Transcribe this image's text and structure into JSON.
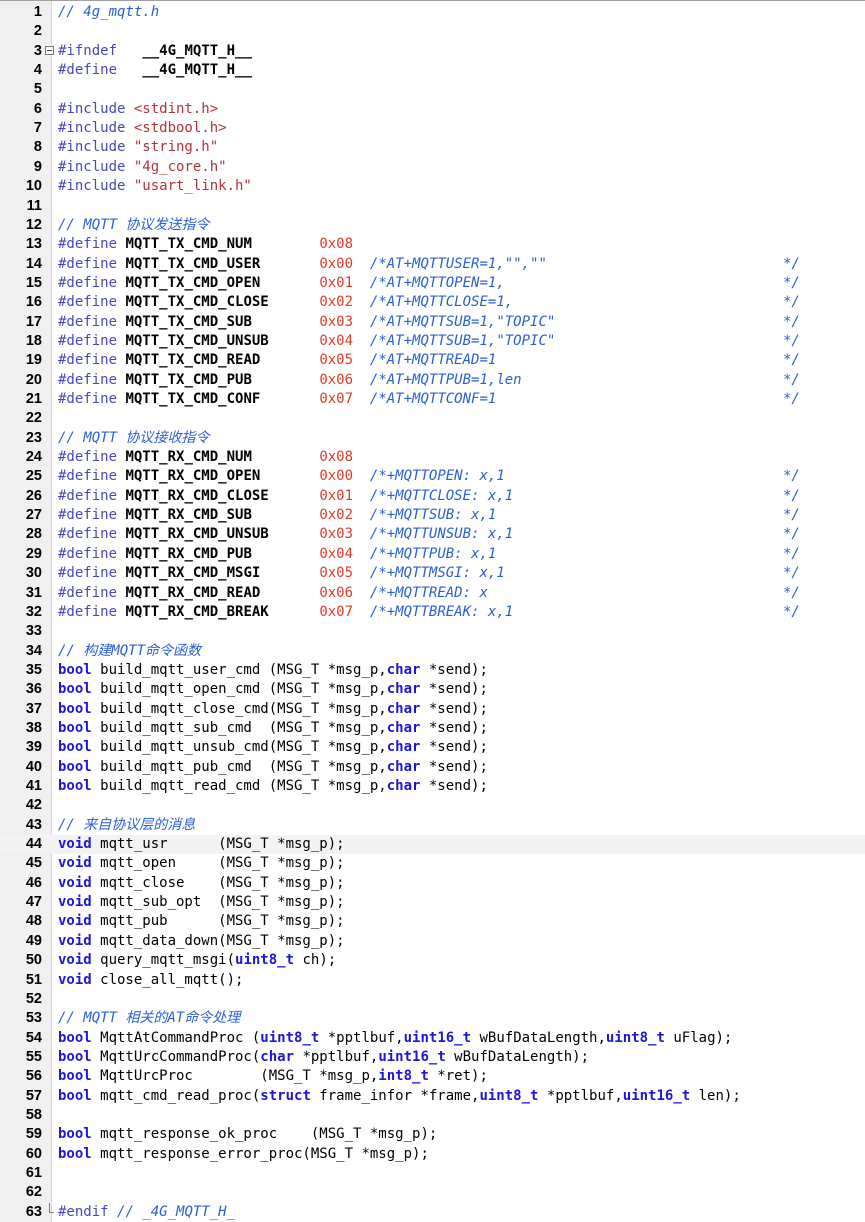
{
  "file_title": "4g_mqtt.h",
  "colors": {
    "preprocessor": "#4848b8",
    "comment": "#2a5fd4",
    "string": "#b2333a",
    "number": "#e03a28",
    "keyword_type": "#1c17d6",
    "gutter_bg": "#f0f0f0"
  },
  "lines": [
    [
      [
        "cm",
        "// 4g_mqtt.h"
      ]
    ],
    [],
    [
      [
        "pp",
        "#ifndef"
      ],
      [
        "pl",
        "   "
      ],
      [
        "def",
        "__4G_MQTT_H__"
      ]
    ],
    [
      [
        "pp",
        "#define"
      ],
      [
        "pl",
        "   "
      ],
      [
        "def",
        "__4G_MQTT_H__"
      ]
    ],
    [],
    [
      [
        "pp",
        "#include "
      ],
      [
        "str",
        "<stdint.h>"
      ]
    ],
    [
      [
        "pp",
        "#include "
      ],
      [
        "str",
        "<stdbool.h>"
      ]
    ],
    [
      [
        "pp",
        "#include "
      ],
      [
        "str",
        "\"string.h\""
      ]
    ],
    [
      [
        "pp",
        "#include "
      ],
      [
        "str",
        "\"4g_core.h\""
      ]
    ],
    [
      [
        "pp",
        "#include "
      ],
      [
        "str",
        "\"usart_link.h\""
      ]
    ],
    [],
    [
      [
        "cm",
        "// MQTT 协议发送指令"
      ]
    ],
    [
      [
        "pp",
        "#define "
      ],
      [
        "def",
        "MQTT_TX_CMD_NUM"
      ],
      [
        "pl",
        "        "
      ],
      [
        "num",
        "0x08"
      ]
    ],
    [
      [
        "pp",
        "#define "
      ],
      [
        "def",
        "MQTT_TX_CMD_USER"
      ],
      [
        "pl",
        "       "
      ],
      [
        "num",
        "0x00"
      ],
      [
        "pl",
        "  "
      ],
      [
        "cm",
        "/*AT+MQTTUSER=1,\"\",\"\""
      ],
      [
        "cmend",
        "*/"
      ]
    ],
    [
      [
        "pp",
        "#define "
      ],
      [
        "def",
        "MQTT_TX_CMD_OPEN"
      ],
      [
        "pl",
        "       "
      ],
      [
        "num",
        "0x01"
      ],
      [
        "pl",
        "  "
      ],
      [
        "cm",
        "/*AT+MQTTOPEN=1,"
      ],
      [
        "cmend",
        "*/"
      ]
    ],
    [
      [
        "pp",
        "#define "
      ],
      [
        "def",
        "MQTT_TX_CMD_CLOSE"
      ],
      [
        "pl",
        "      "
      ],
      [
        "num",
        "0x02"
      ],
      [
        "pl",
        "  "
      ],
      [
        "cm",
        "/*AT+MQTTCLOSE=1,"
      ],
      [
        "cmend",
        "*/"
      ]
    ],
    [
      [
        "pp",
        "#define "
      ],
      [
        "def",
        "MQTT_TX_CMD_SUB"
      ],
      [
        "pl",
        "        "
      ],
      [
        "num",
        "0x03"
      ],
      [
        "pl",
        "  "
      ],
      [
        "cm",
        "/*AT+MQTTSUB=1,\"TOPIC\""
      ],
      [
        "cmend",
        "*/"
      ]
    ],
    [
      [
        "pp",
        "#define "
      ],
      [
        "def",
        "MQTT_TX_CMD_UNSUB"
      ],
      [
        "pl",
        "      "
      ],
      [
        "num",
        "0x04"
      ],
      [
        "pl",
        "  "
      ],
      [
        "cm",
        "/*AT+MQTTSUB=1,\"TOPIC\""
      ],
      [
        "cmend",
        "*/"
      ]
    ],
    [
      [
        "pp",
        "#define "
      ],
      [
        "def",
        "MQTT_TX_CMD_READ"
      ],
      [
        "pl",
        "       "
      ],
      [
        "num",
        "0x05"
      ],
      [
        "pl",
        "  "
      ],
      [
        "cm",
        "/*AT+MQTTREAD=1"
      ],
      [
        "cmend",
        "*/"
      ]
    ],
    [
      [
        "pp",
        "#define "
      ],
      [
        "def",
        "MQTT_TX_CMD_PUB"
      ],
      [
        "pl",
        "        "
      ],
      [
        "num",
        "0x06"
      ],
      [
        "pl",
        "  "
      ],
      [
        "cm",
        "/*AT+MQTTPUB=1,len"
      ],
      [
        "cmend",
        "*/"
      ]
    ],
    [
      [
        "pp",
        "#define "
      ],
      [
        "def",
        "MQTT_TX_CMD_CONF"
      ],
      [
        "pl",
        "       "
      ],
      [
        "num",
        "0x07"
      ],
      [
        "pl",
        "  "
      ],
      [
        "cm",
        "/*AT+MQTTCONF=1"
      ],
      [
        "cmend",
        "*/"
      ]
    ],
    [],
    [
      [
        "cm",
        "// MQTT 协议接收指令"
      ]
    ],
    [
      [
        "pp",
        "#define "
      ],
      [
        "def",
        "MQTT_RX_CMD_NUM"
      ],
      [
        "pl",
        "        "
      ],
      [
        "num",
        "0x08"
      ]
    ],
    [
      [
        "pp",
        "#define "
      ],
      [
        "def",
        "MQTT_RX_CMD_OPEN"
      ],
      [
        "pl",
        "       "
      ],
      [
        "num",
        "0x00"
      ],
      [
        "pl",
        "  "
      ],
      [
        "cm",
        "/*+MQTTOPEN: x,1"
      ],
      [
        "cmend",
        "*/"
      ]
    ],
    [
      [
        "pp",
        "#define "
      ],
      [
        "def",
        "MQTT_RX_CMD_CLOSE"
      ],
      [
        "pl",
        "      "
      ],
      [
        "num",
        "0x01"
      ],
      [
        "pl",
        "  "
      ],
      [
        "cm",
        "/*+MQTTCLOSE: x,1"
      ],
      [
        "cmend",
        "*/"
      ]
    ],
    [
      [
        "pp",
        "#define "
      ],
      [
        "def",
        "MQTT_RX_CMD_SUB"
      ],
      [
        "pl",
        "        "
      ],
      [
        "num",
        "0x02"
      ],
      [
        "pl",
        "  "
      ],
      [
        "cm",
        "/*+MQTTSUB: x,1"
      ],
      [
        "cmend",
        "*/"
      ]
    ],
    [
      [
        "pp",
        "#define "
      ],
      [
        "def",
        "MQTT_RX_CMD_UNSUB"
      ],
      [
        "pl",
        "      "
      ],
      [
        "num",
        "0x03"
      ],
      [
        "pl",
        "  "
      ],
      [
        "cm",
        "/*+MQTTUNSUB: x,1"
      ],
      [
        "cmend",
        "*/"
      ]
    ],
    [
      [
        "pp",
        "#define "
      ],
      [
        "def",
        "MQTT_RX_CMD_PUB"
      ],
      [
        "pl",
        "        "
      ],
      [
        "num",
        "0x04"
      ],
      [
        "pl",
        "  "
      ],
      [
        "cm",
        "/*+MQTTPUB: x,1"
      ],
      [
        "cmend",
        "*/"
      ]
    ],
    [
      [
        "pp",
        "#define "
      ],
      [
        "def",
        "MQTT_RX_CMD_MSGI"
      ],
      [
        "pl",
        "       "
      ],
      [
        "num",
        "0x05"
      ],
      [
        "pl",
        "  "
      ],
      [
        "cm",
        "/*+MQTTMSGI: x,1"
      ],
      [
        "cmend",
        "*/"
      ]
    ],
    [
      [
        "pp",
        "#define "
      ],
      [
        "def",
        "MQTT_RX_CMD_READ"
      ],
      [
        "pl",
        "       "
      ],
      [
        "num",
        "0x06"
      ],
      [
        "pl",
        "  "
      ],
      [
        "cm",
        "/*+MQTTREAD: x"
      ],
      [
        "cmend",
        "*/"
      ]
    ],
    [
      [
        "pp",
        "#define "
      ],
      [
        "def",
        "MQTT_RX_CMD_BREAK"
      ],
      [
        "pl",
        "      "
      ],
      [
        "num",
        "0x07"
      ],
      [
        "pl",
        "  "
      ],
      [
        "cm",
        "/*+MQTTBREAK: x,1"
      ],
      [
        "cmend",
        "*/"
      ]
    ],
    [],
    [
      [
        "cm",
        "// 构建MQTT命令函数"
      ]
    ],
    [
      [
        "type",
        "bool"
      ],
      [
        "id",
        " build_mqtt_user_cmd (MSG_T *msg_p,"
      ],
      [
        "type",
        "char"
      ],
      [
        "id",
        " *send);"
      ]
    ],
    [
      [
        "type",
        "bool"
      ],
      [
        "id",
        " build_mqtt_open_cmd (MSG_T *msg_p,"
      ],
      [
        "type",
        "char"
      ],
      [
        "id",
        " *send);"
      ]
    ],
    [
      [
        "type",
        "bool"
      ],
      [
        "id",
        " build_mqtt_close_cmd(MSG_T *msg_p,"
      ],
      [
        "type",
        "char"
      ],
      [
        "id",
        " *send);"
      ]
    ],
    [
      [
        "type",
        "bool"
      ],
      [
        "id",
        " build_mqtt_sub_cmd  (MSG_T *msg_p,"
      ],
      [
        "type",
        "char"
      ],
      [
        "id",
        " *send);"
      ]
    ],
    [
      [
        "type",
        "bool"
      ],
      [
        "id",
        " build_mqtt_unsub_cmd(MSG_T *msg_p,"
      ],
      [
        "type",
        "char"
      ],
      [
        "id",
        " *send);"
      ]
    ],
    [
      [
        "type",
        "bool"
      ],
      [
        "id",
        " build_mqtt_pub_cmd  (MSG_T *msg_p,"
      ],
      [
        "type",
        "char"
      ],
      [
        "id",
        " *send);"
      ]
    ],
    [
      [
        "type",
        "bool"
      ],
      [
        "id",
        " build_mqtt_read_cmd (MSG_T *msg_p,"
      ],
      [
        "type",
        "char"
      ],
      [
        "id",
        " *send);"
      ]
    ],
    [],
    [
      [
        "cm",
        "// 来自协议层的消息"
      ]
    ],
    [
      [
        "type",
        "void"
      ],
      [
        "id",
        " mqtt_usr      (MSG_T *msg_p);"
      ]
    ],
    [
      [
        "type",
        "void"
      ],
      [
        "id",
        " mqtt_open     (MSG_T *msg_p);"
      ]
    ],
    [
      [
        "type",
        "void"
      ],
      [
        "id",
        " mqtt_close    (MSG_T *msg_p);"
      ]
    ],
    [
      [
        "type",
        "void"
      ],
      [
        "id",
        " mqtt_sub_opt  (MSG_T *msg_p);"
      ]
    ],
    [
      [
        "type",
        "void"
      ],
      [
        "id",
        " mqtt_pub      (MSG_T *msg_p);"
      ]
    ],
    [
      [
        "type",
        "void"
      ],
      [
        "id",
        " mqtt_data_down(MSG_T *msg_p);"
      ]
    ],
    [
      [
        "type",
        "void"
      ],
      [
        "id",
        " query_mqtt_msgi("
      ],
      [
        "type",
        "uint8_t"
      ],
      [
        "id",
        " ch);"
      ]
    ],
    [
      [
        "type",
        "void"
      ],
      [
        "id",
        " close_all_mqtt();"
      ]
    ],
    [],
    [
      [
        "cm",
        "// MQTT 相关的AT命令处理"
      ]
    ],
    [
      [
        "type",
        "bool"
      ],
      [
        "id",
        " MqttAtCommandProc ("
      ],
      [
        "type",
        "uint8_t"
      ],
      [
        "id",
        " *pptlbuf,"
      ],
      [
        "type",
        "uint16_t"
      ],
      [
        "id",
        " wBufDataLength,"
      ],
      [
        "type",
        "uint8_t"
      ],
      [
        "id",
        " uFlag);"
      ]
    ],
    [
      [
        "type",
        "bool"
      ],
      [
        "id",
        " MqttUrcCommandProc("
      ],
      [
        "type",
        "char"
      ],
      [
        "id",
        " *pptlbuf,"
      ],
      [
        "type",
        "uint16_t"
      ],
      [
        "id",
        " wBufDataLength);"
      ]
    ],
    [
      [
        "type",
        "bool"
      ],
      [
        "id",
        " MqttUrcProc        (MSG_T *msg_p,"
      ],
      [
        "type",
        "int8_t"
      ],
      [
        "id",
        " *ret);"
      ]
    ],
    [
      [
        "type",
        "bool"
      ],
      [
        "id",
        " mqtt_cmd_read_proc("
      ],
      [
        "type",
        "struct"
      ],
      [
        "id",
        " frame_infor *frame,"
      ],
      [
        "type",
        "uint8_t"
      ],
      [
        "id",
        " *pptlbuf,"
      ],
      [
        "type",
        "uint16_t"
      ],
      [
        "id",
        " len);"
      ]
    ],
    [],
    [
      [
        "type",
        "bool"
      ],
      [
        "id",
        " mqtt_response_ok_proc    (MSG_T *msg_p);"
      ]
    ],
    [
      [
        "type",
        "bool"
      ],
      [
        "id",
        " mqtt_response_error_proc(MSG_T *msg_p);"
      ]
    ],
    [],
    [],
    [
      [
        "pp",
        "#endif "
      ],
      [
        "cm",
        "// _4G_MQTT_H_"
      ]
    ]
  ]
}
